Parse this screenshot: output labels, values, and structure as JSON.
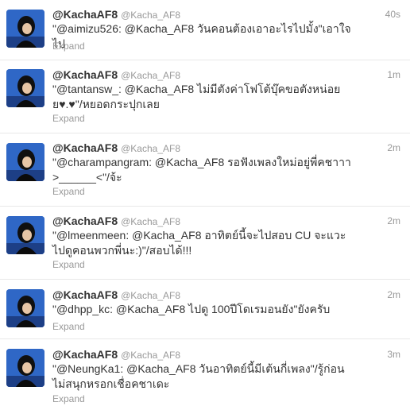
{
  "tweets": [
    {
      "fullname": "@KachaAF8",
      "username": "@Kacha_AF8",
      "time": "40s",
      "text": "\"@aimizu526: @Kacha_AF8 วันคอนต้องเอาอะไรไปมั้ง\"เอาใจไป",
      "expand": "Expand"
    },
    {
      "fullname": "@KachaAF8",
      "username": "@Kacha_AF8",
      "time": "1m",
      "text": "\"@tantansw_: @Kacha_AF8 ไม่มีตังค่าโฟโต้บุ๊คขอตังหน่อยย♥.♥\"/หยอดกระปุกเลย",
      "expand": "Expand"
    },
    {
      "fullname": "@KachaAF8",
      "username": "@Kacha_AF8",
      "time": "2m",
      "text": "\"@charampangram: @Kacha_AF8 รอฟังเพลงใหม่อยู่พี่คชาาา >______<\"/จ้ะ",
      "expand": "Expand"
    },
    {
      "fullname": "@KachaAF8",
      "username": "@Kacha_AF8",
      "time": "2m",
      "text": "\"@lmeenmeen: @Kacha_AF8 อาทิตย์นี้จะไปสอบ CU จะแวะไปดูคอนพวกพี่นะ:)\"/สอบได้!!!",
      "expand": "Expand"
    },
    {
      "fullname": "@KachaAF8",
      "username": "@Kacha_AF8",
      "time": "2m",
      "text": "\"@dhpp_kc: @Kacha_AF8 ไปดู 100ปีโดเรมอนยัง\"ยังครับ",
      "expand": "Expand"
    },
    {
      "fullname": "@KachaAF8",
      "username": "@Kacha_AF8",
      "time": "3m",
      "text": "\"@NeungKa1: @Kacha_AF8 วันอาทิตย์นี้มีเต้นกี่เพลง\"/รู้ก่อนไม่สนุกหรอกเชื่อคชาเดะ",
      "expand": "Expand"
    }
  ]
}
